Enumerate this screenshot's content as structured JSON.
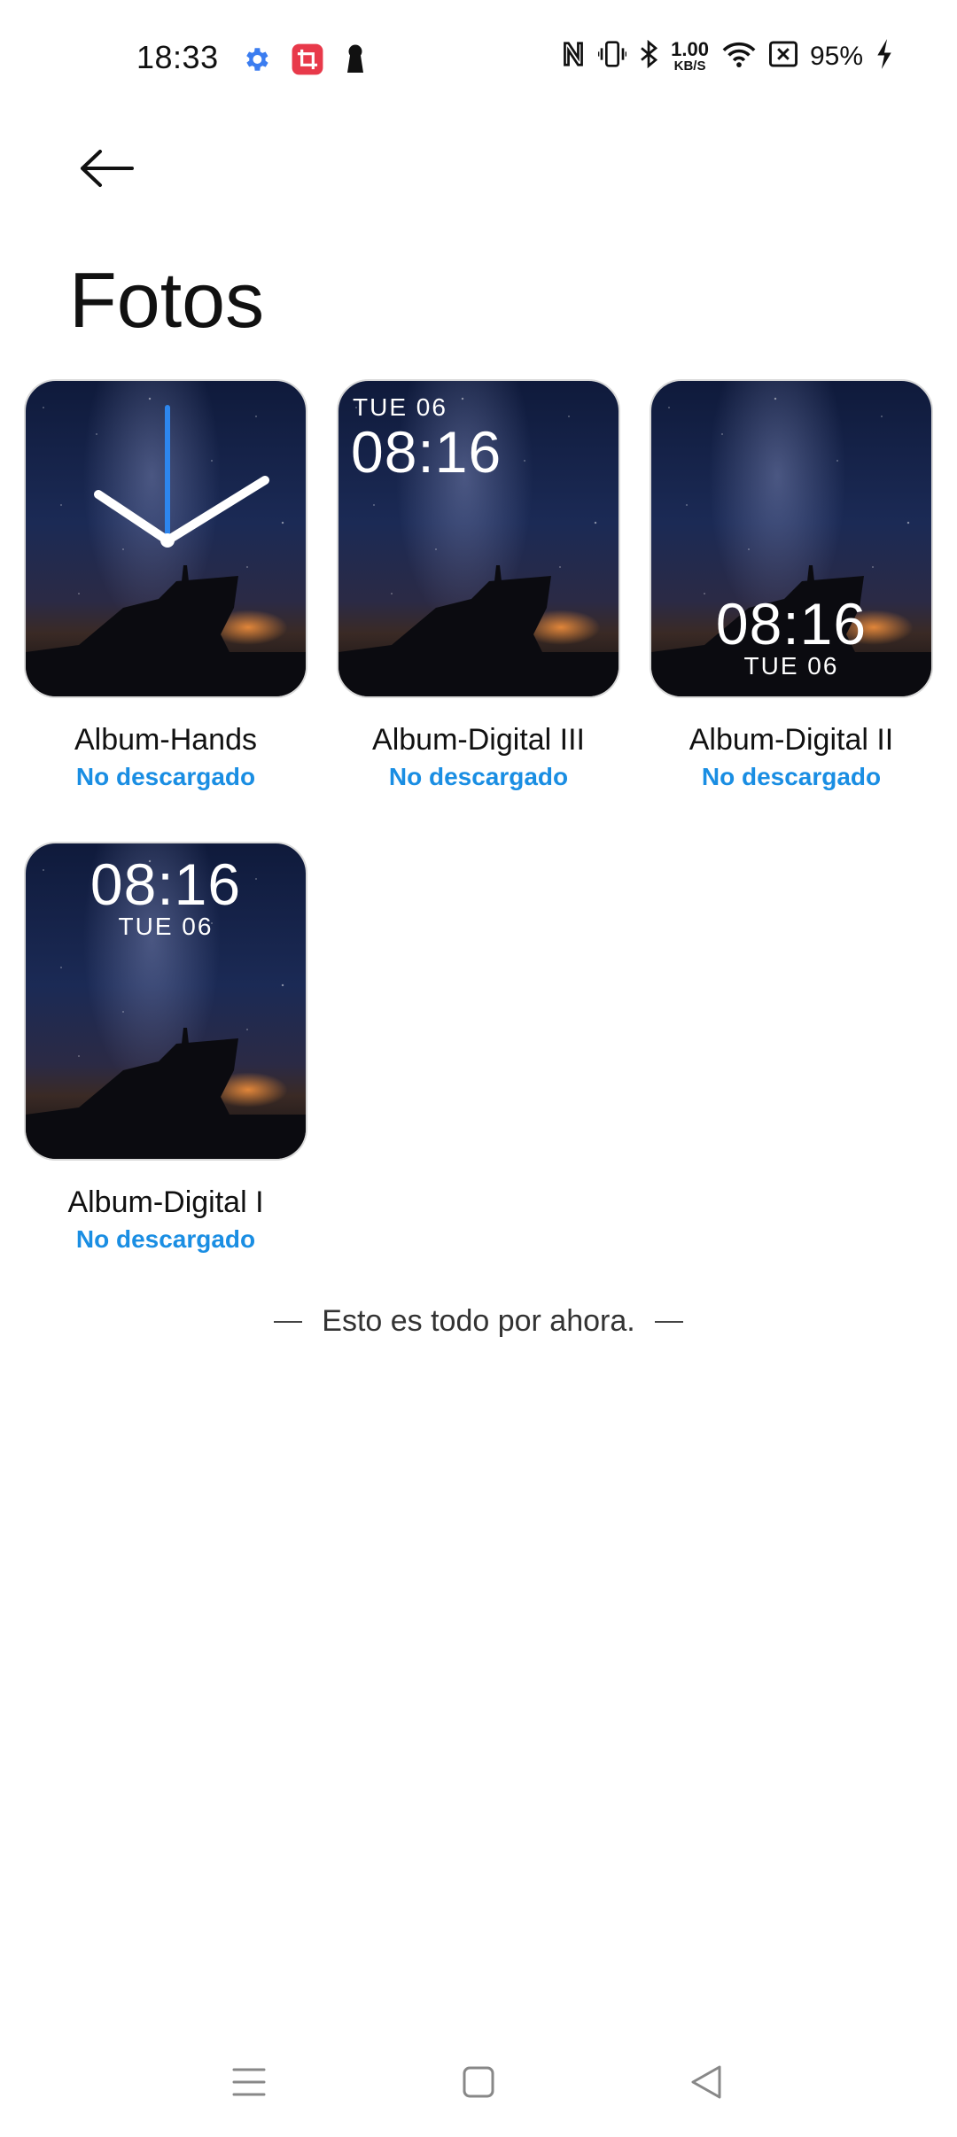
{
  "status_bar": {
    "time": "18:33",
    "net_speed_value": "1.00",
    "net_speed_unit": "KB/S",
    "battery": "95%",
    "icons": [
      "settings-icon",
      "screenshot-crop-icon",
      "keyhole-icon",
      "nfc-icon",
      "vibrate-icon",
      "bluetooth-icon",
      "wifi-icon",
      "sim-off-icon",
      "charging-icon"
    ],
    "colors": {
      "settings": "#3b7df0",
      "crop_bg": "#e8394a"
    }
  },
  "header": {
    "back_icon": "arrow-left-icon",
    "title": "Fotos"
  },
  "watch_faces": [
    {
      "name": "Album-Hands",
      "status": "No descargado",
      "style": "hands"
    },
    {
      "name": "Album-Digital III",
      "status": "No descargado",
      "style": "digital-top-left",
      "date": "TUE 06",
      "time": "08:16"
    },
    {
      "name": "Album-Digital II",
      "status": "No descargado",
      "style": "digital-bottom",
      "date": "TUE 06",
      "time": "08:16"
    },
    {
      "name": "Album-Digital I",
      "status": "No descargado",
      "style": "digital-top-center",
      "date": "TUE 06",
      "time": "08:16"
    }
  ],
  "footer_note": "Esto es todo por ahora.",
  "nav_bar": {
    "items": [
      "menu-icon",
      "home-icon",
      "back-triangle-icon"
    ]
  },
  "colors": {
    "accent": "#1a8ee3",
    "text": "#111111",
    "background": "#ffffff"
  }
}
